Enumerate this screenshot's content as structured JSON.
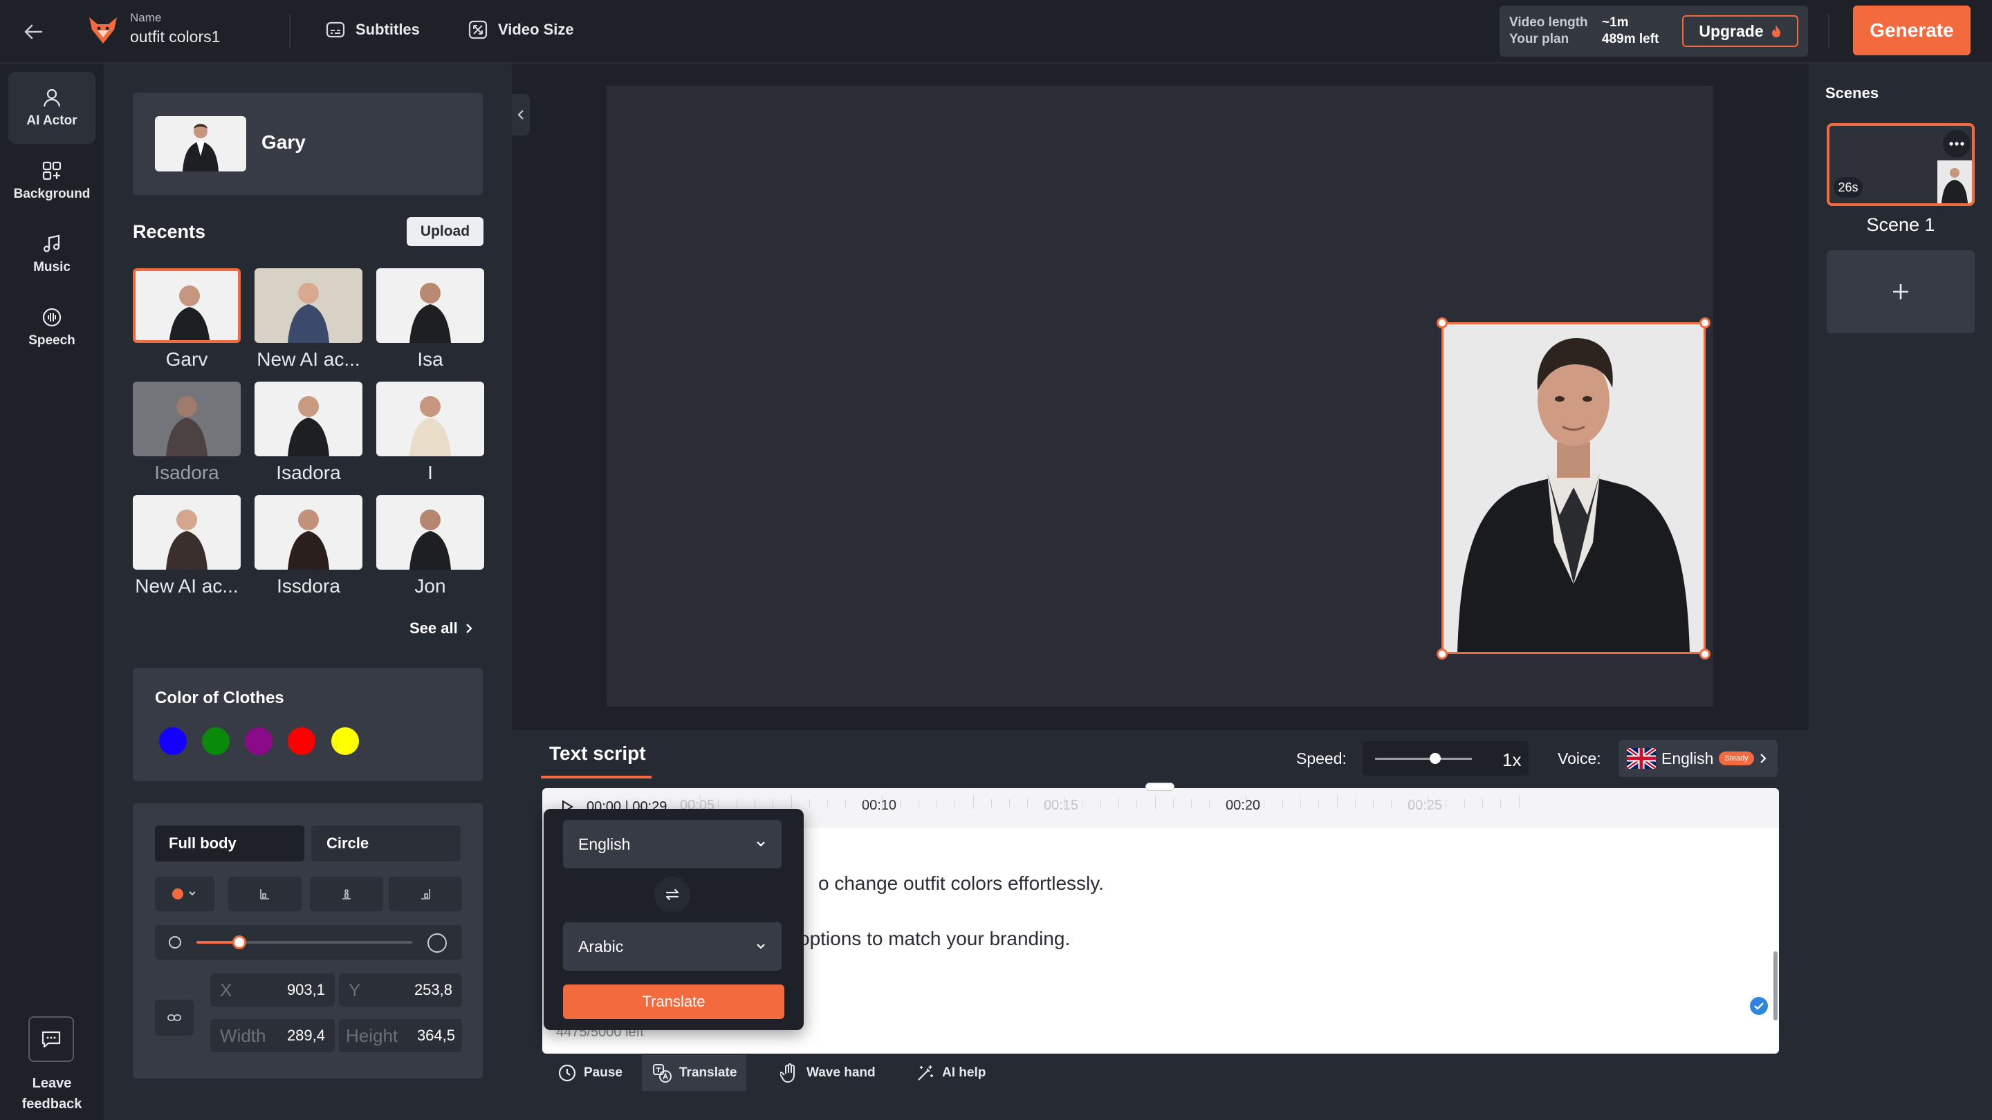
{
  "header": {
    "name_label": "Name",
    "project_name": "outfit colors1",
    "subtitles_label": "Subtitles",
    "video_size_label": "Video Size",
    "video_length_label": "Video length",
    "video_length_value": "~1m",
    "plan_label": "Your plan",
    "plan_value": "489m left",
    "upgrade_label": "Upgrade",
    "generate_label": "Generate"
  },
  "rail": {
    "items": [
      {
        "label": "AI Actor",
        "icon": "person-icon",
        "active": true
      },
      {
        "label": "Background",
        "icon": "grid-plus-icon",
        "active": false
      },
      {
        "label": "Music",
        "icon": "music-note-icon",
        "active": false
      },
      {
        "label": "Speech",
        "icon": "microphone-icon",
        "active": false
      }
    ],
    "feedback_line1": "Leave",
    "feedback_line2": "feedback"
  },
  "panel": {
    "selected_actor": "Gary",
    "recents_title": "Recents",
    "upload_label": "Upload",
    "actors": [
      "Garv",
      "New AI ac...",
      "Isa",
      "Isadora",
      "Isadora",
      "I",
      "New AI ac...",
      "Issdora",
      "Jon"
    ],
    "see_all_label": "See all",
    "color_title": "Color of Clothes",
    "colors": [
      "#1400ff",
      "#0a8a0a",
      "#8a0a8a",
      "#ff0000",
      "#ffff00"
    ],
    "full_body_label": "Full body",
    "circle_label": "Circle",
    "x_label": "X",
    "x_value": "903,1",
    "y_label": "Y",
    "y_value": "253,8",
    "width_label": "Width",
    "width_value": "289,4",
    "height_label": "Height",
    "height_value": "364,5",
    "size_slider_fraction": 0.2
  },
  "scenes": {
    "title": "Scenes",
    "items": [
      {
        "label": "Scene 1",
        "duration": "26s"
      }
    ]
  },
  "script": {
    "tab_label": "Text script",
    "speed_label": "Speed:",
    "speed_value": "1x",
    "speed_fraction": 0.62,
    "voice_label": "Voice:",
    "voice_language": "English",
    "voice_badge": "Steady",
    "timecode": "00:00 | 00:29",
    "ticks": [
      "00:05",
      "00:10",
      "00:15",
      "00:20",
      "00:25"
    ],
    "line1": "o change outfit colors effortlessly.",
    "line2": "options to match your branding.",
    "chars_left": "4475/5000 left",
    "toolbar": [
      "Pause",
      "Translate",
      "Wave hand",
      "AI help"
    ]
  },
  "translate_popup": {
    "from_language": "English",
    "to_language": "Arabic",
    "button_label": "Translate"
  },
  "colors": {
    "accent": "#f26a3d",
    "bg": "#1e2128",
    "panel": "#262a33",
    "card": "#373b45"
  }
}
